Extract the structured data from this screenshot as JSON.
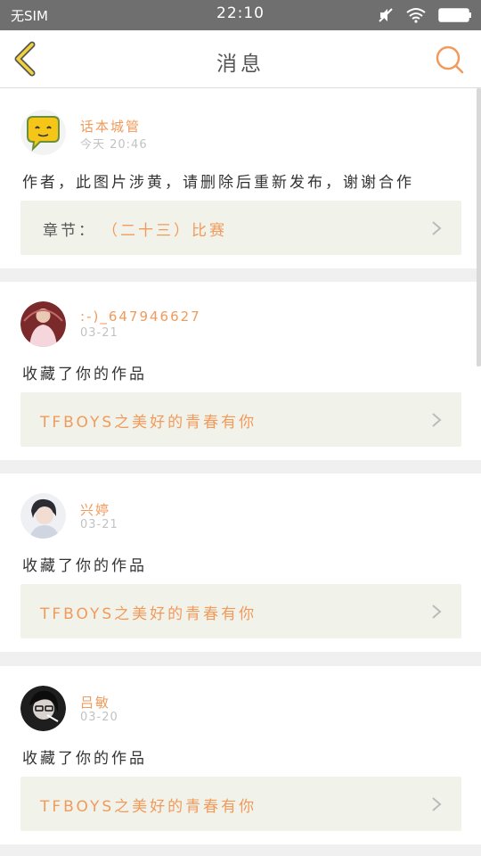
{
  "status_bar": {
    "carrier": "无SIM",
    "time": "22:10",
    "icons": [
      "mute-icon",
      "wifi-icon",
      "battery-icon"
    ]
  },
  "header": {
    "title": "消息",
    "back_icon": "chevron-left-icon",
    "search_icon": "search-icon",
    "accent_color": "#f19a5c"
  },
  "messages": [
    {
      "user": "话本城管",
      "time": "今天 20:46",
      "text": "作者，此图片涉黄，请删除后重新发布，谢谢合作",
      "ref_label": "章节：",
      "ref_title": "（二十三）比赛"
    },
    {
      "user": ":-)_647946627",
      "time": "03-21",
      "text": "收藏了你的作品",
      "ref_label": "",
      "ref_title": "TFBOYS之美好的青春有你"
    },
    {
      "user": "兴婷",
      "time": "03-21",
      "text": "收藏了你的作品",
      "ref_label": "",
      "ref_title": "TFBOYS之美好的青春有你"
    },
    {
      "user": "吕敏",
      "time": "03-20",
      "text": "收藏了你的作品",
      "ref_label": "",
      "ref_title": "TFBOYS之美好的青春有你"
    }
  ]
}
